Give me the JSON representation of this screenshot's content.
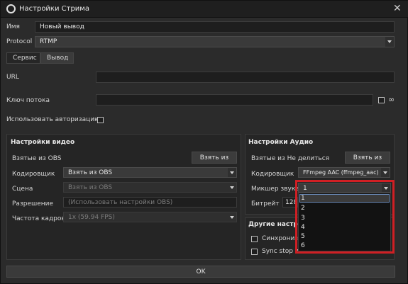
{
  "window": {
    "title": "Настройки Стрима",
    "close_glyph": "✕",
    "icon": "obs-icon"
  },
  "general": {
    "name_label": "Имя",
    "name_value": "Новый вывод",
    "protocol_label": "Protocol",
    "protocol_value": "RTMP"
  },
  "tabs": [
    {
      "label": "Сервис",
      "active": false
    },
    {
      "label": "Вывод",
      "active": true
    }
  ],
  "connection": {
    "url_label": "URL",
    "url_value": "",
    "key_label": "Ключ потока",
    "key_value": "",
    "auth_label": "Использовать авторизацию"
  },
  "video": {
    "title": "Настройки видео",
    "from_obs_label": "Взятые из OBS",
    "from_obs_button": "Взять из",
    "encoder_label": "Кодировщик",
    "encoder_value": "Взять из OBS",
    "scene_label": "Сцена",
    "scene_value": "Взять из OBS",
    "resolution_label": "Разрешение",
    "resolution_value": "(Использовать настройки OBS)",
    "fps_label": "Частота кадров",
    "fps_value": "1x (59.94 FPS)"
  },
  "audio": {
    "title": "Настройки Аудио",
    "from_label": "Взятые из Не делиться",
    "from_button": "Взять из",
    "encoder_label": "Кодировщик",
    "encoder_value": "FFmpeg AAC (ffmpeg_aac)",
    "mixer_label": "Микшер звука",
    "mixer_value": "1",
    "bitrate_label": "Битрейт",
    "bitrate_value": "128",
    "mixer_options": [
      "1",
      "2",
      "3",
      "4",
      "5",
      "6"
    ]
  },
  "other": {
    "title": "Другие настро",
    "sync_label": "Синхрониз",
    "sync_stop_label": "Sync stop w"
  },
  "footer": {
    "ok_label": "OK"
  },
  "colors": {
    "highlight_border": "#d01f24",
    "background": "#2b2b2b"
  }
}
